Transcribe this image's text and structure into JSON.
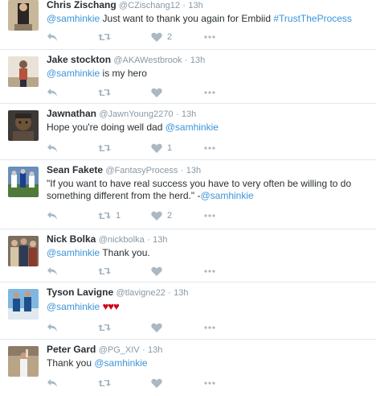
{
  "tweets": [
    {
      "name": "Chris Zischang",
      "handle": "@CZischang12",
      "time": "13h",
      "mention": "@samhinkie",
      "text": " Just want to thank you again for Embiid ",
      "hashtag": "#TrustTheProcess",
      "retweets": "",
      "likes": "2"
    },
    {
      "name": "Jake stockton",
      "handle": "@AKAWestbrook",
      "time": "13h",
      "mention": "@samhinkie",
      "text": " is my hero",
      "retweets": "",
      "likes": ""
    },
    {
      "name": "Jawnathan",
      "handle": "@JawnYoung2270",
      "time": "13h",
      "text": "Hope you're doing well dad ",
      "mention": "@samhinkie",
      "retweets": "",
      "likes": "1"
    },
    {
      "name": "Sean Fakete",
      "handle": "@FantasyProcess",
      "time": "13h",
      "text": "\"If you want to have real success you have to very often be willing to do something different from the herd.\" -",
      "mention": "@samhinkie",
      "retweets": "1",
      "likes": "2"
    },
    {
      "name": "Nick Bolka",
      "handle": "@nickbolka",
      "time": "13h",
      "mention": "@samhinkie",
      "text": " Thank you.",
      "retweets": "",
      "likes": ""
    },
    {
      "name": "Tyson Lavigne",
      "handle": "@tlavigne22",
      "time": "13h",
      "mention": "@samhinkie",
      "text": " ",
      "hearts": "♥♥♥",
      "retweets": "",
      "likes": ""
    },
    {
      "name": "Peter Gard",
      "handle": "@PG_XIV",
      "time": "13h",
      "text": "Thank you ",
      "mention": "@samhinkie",
      "retweets": "",
      "likes": ""
    }
  ],
  "colors": {
    "link": "#3b94d9",
    "icon": "#aab8c2",
    "meta": "#8899a6",
    "heart_emoji": "#d0021b"
  },
  "icons": {
    "reply": "reply-icon",
    "retweet": "retweet-icon",
    "like": "heart-icon",
    "more": "more-icon"
  }
}
